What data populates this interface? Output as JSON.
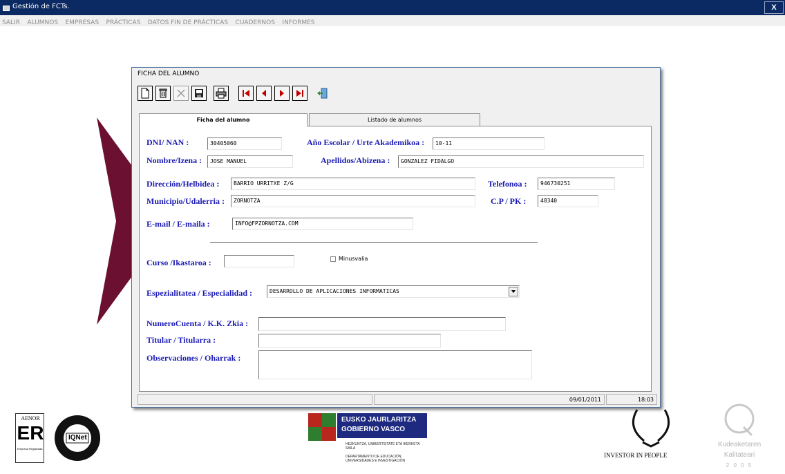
{
  "app": {
    "title": "Gestión de FCTs.",
    "close": "X"
  },
  "menu": [
    "SALIR",
    "ALUMNOS",
    "EMPRESAS",
    "PRÁCTICAS",
    "DATOS FIN DE PRÁCTICAS",
    "CUADERNOS",
    "INFORMES"
  ],
  "window": {
    "title": "FICHA DEL ALUMNO"
  },
  "toolbar": [
    "new-doc-icon",
    "delete-icon",
    "cancel-icon",
    "save-icon",
    "print-icon",
    "first-record-icon",
    "previous-record-icon",
    "next-record-icon",
    "last-record-icon",
    "exit-door-icon"
  ],
  "tabs": {
    "ficha": "Ficha del alumno",
    "listado": "Listado de alumnos"
  },
  "form": {
    "dni_label": "DNI/ NAN :",
    "dni_value": "30405060",
    "ano_label": "Año Escolar / Urte Akademikoa :",
    "ano_value": "10-11",
    "nombre_label": "Nombre/Izena :",
    "nombre_value": "JOSE MANUEL",
    "apellidos_label": "Apellidos/Abizena :",
    "apellidos_value": "GONZALEZ FIDALGO",
    "direccion_label": "Dirección/Helbidea :",
    "direccion_value": "BARRIO URRITXE Z/G",
    "telefono_label": "Telefonoa :",
    "telefono_value": "946730251",
    "municipio_label": "Municipio/Udalerria :",
    "municipio_value": "ZORNOTZA",
    "cp_label": "C.P / PK :",
    "cp_value": "48340",
    "email_label": "E-mail / E-maila :",
    "email_value": "INFO@FPZORNOTZA.COM",
    "curso_label": "Curso /Ikastaroa :",
    "curso_value": "",
    "minusvalia_label": "Minusvalia",
    "minusvalia_checked": false,
    "especialidad_label": "Espezialitatea / Especialidad :",
    "especialidad_value": "DESARROLLO DE APLICACIONES INFORMATICAS",
    "cuenta_label": "NumeroCuenta / K.K. Zkia :",
    "cuenta_value": "",
    "titular_label": "Titular / Titularra :",
    "titular_value": "",
    "observaciones_label": "Observaciones / Oharrak :",
    "observaciones_value": ""
  },
  "status": {
    "date": "09/01/2011",
    "time": "18:03"
  },
  "logos": {
    "aenor_name": "AENOR",
    "aenor_mark": "ER",
    "aenor_sub": "Empresa Registrada",
    "iqnet": "IQNet",
    "basque_line1": "EUSKO JAURLARITZA",
    "basque_line2": "GOBIERNO VASCO",
    "basque_dept1": "HEZKUNTZA, UNIBERTSITATE ETA IKERKETA SAILA",
    "basque_dept2": "DEPARTAMENTO DE EDUCACIÓN, UNIVERSIDADES E INVESTIGACIÓN",
    "iip": "INVESTOR IN PEOPLE",
    "kq_line1": "Kudeaketaren",
    "kq_line2": "Kalitateari",
    "kq_line3": "2 0 0 5"
  },
  "colors": {
    "titlebar": "#0b2a63",
    "label_blue": "#1a1ab4",
    "wedge": "#6c1032",
    "basque_blue": "#1d2a80",
    "nav_red": "#c00000"
  }
}
